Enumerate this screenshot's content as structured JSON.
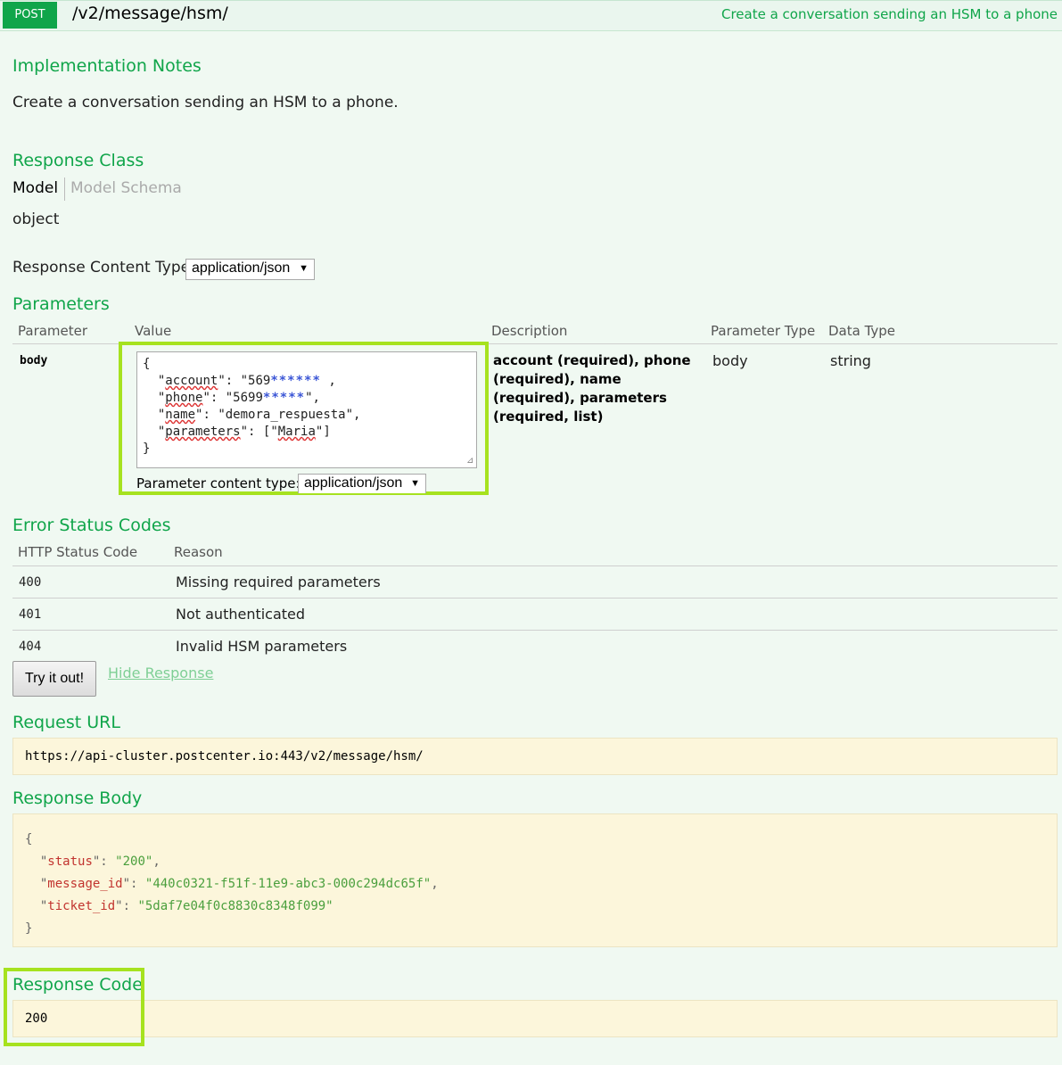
{
  "header": {
    "method": "POST",
    "path": "/v2/message/hsm/",
    "summary": "Create a conversation sending an HSM to a phone"
  },
  "implementation": {
    "title": "Implementation Notes",
    "text": "Create a conversation sending an HSM to a phone."
  },
  "response_class": {
    "title": "Response Class",
    "tab_model": "Model",
    "tab_schema": "Model Schema",
    "value": "object"
  },
  "response_content_type": {
    "label": "Response Content Type",
    "selected": "application/json"
  },
  "parameters": {
    "title": "Parameters",
    "columns": [
      "Parameter",
      "Value",
      "Description",
      "Parameter Type",
      "Data Type"
    ],
    "row": {
      "name": "body",
      "value_lines": {
        "open": "{",
        "account_key": "account",
        "account_val": "\"569",
        "account_stars": "******",
        "account_end": " ,",
        "phone_key": "phone",
        "phone_val": "\"5699",
        "phone_stars": "*****",
        "phone_end": "\",",
        "name_key": "name",
        "name_val": "\"demora_respuesta\",",
        "params_key": "parameters",
        "params_val_pre": "[\"",
        "params_val_word": "Maria",
        "params_val_post": "\"]",
        "close": "}"
      },
      "description": "account (required), phone (required), name (required), parameters (required, list)",
      "param_type": "body",
      "data_type": "string"
    },
    "content_type_label": "Parameter content type:",
    "content_type_selected": "application/json"
  },
  "error_codes": {
    "title": "Error Status Codes",
    "columns": [
      "HTTP Status Code",
      "Reason"
    ],
    "rows": [
      {
        "code": "400",
        "reason": "Missing required parameters"
      },
      {
        "code": "401",
        "reason": "Not authenticated"
      },
      {
        "code": "404",
        "reason": "Invalid HSM parameters"
      }
    ]
  },
  "actions": {
    "try_label": "Try it out!",
    "hide_label": "Hide Response"
  },
  "request_url": {
    "title": "Request URL",
    "value": "https://api-cluster.postcenter.io:443/v2/message/hsm/"
  },
  "response_body": {
    "title": "Response Body",
    "status_key": "status",
    "status_val": "\"200\"",
    "message_key": "message_id",
    "message_val": "\"440c0321-f51f-11e9-abc3-000c294dc65f\"",
    "ticket_key": "ticket_id",
    "ticket_val": "\"5daf7e04f0c8830c8348f099\""
  },
  "response_code": {
    "title": "Response Code",
    "value": "200"
  },
  "colors": {
    "accent_green": "#10a54a",
    "highlight": "#a6e21f",
    "code_bg": "#fcf6db"
  }
}
